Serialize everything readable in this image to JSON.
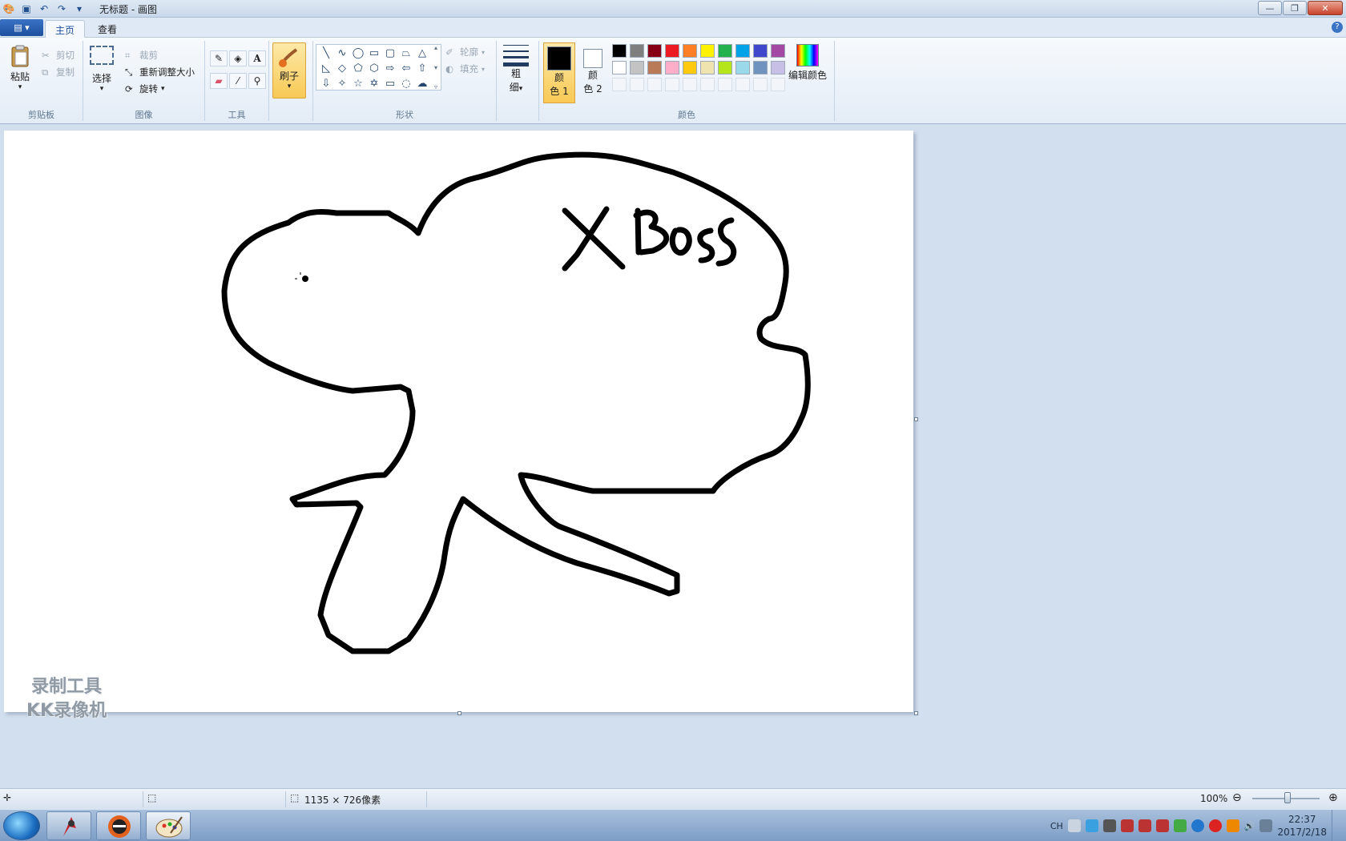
{
  "window": {
    "title": "无标题 - 画图"
  },
  "tabs": [
    {
      "label": "主页"
    },
    {
      "label": "查看"
    }
  ],
  "ribbon": {
    "clipboard": {
      "paste_label": "粘贴",
      "cut_label": "剪切",
      "copy_label": "复制",
      "group_label": "剪贴板"
    },
    "image": {
      "select_label": "选择",
      "crop_label": "裁剪",
      "resize_label": "重新调整大小",
      "rotate_label": "旋转",
      "group_label": "图像"
    },
    "tools": {
      "group_label": "工具"
    },
    "brushes": {
      "label": "刷子"
    },
    "shapes": {
      "outline_label": "轮廓",
      "fill_label": "填充",
      "group_label": "形状"
    },
    "size": {
      "label_line1": "粗",
      "label_line2": "细"
    },
    "colors": {
      "color1_line1": "颜",
      "color1_line2": "色 1",
      "color2_line1": "颜",
      "color2_line2": "色 2",
      "edit_label": "编辑颜色",
      "group_label": "颜色",
      "color1": "#000000",
      "color2": "#ffffff",
      "palette_row1": [
        "#000000",
        "#7f7f7f",
        "#880015",
        "#ed1c24",
        "#ff7f27",
        "#fff200",
        "#22b14c",
        "#00a2e8",
        "#3f48cc",
        "#a349a4"
      ],
      "palette_row2": [
        "#ffffff",
        "#c3c3c3",
        "#b97a57",
        "#ffaec9",
        "#ffc90e",
        "#efe4b0",
        "#b5e61d",
        "#99d9ea",
        "#7092be",
        "#c8bfe7"
      ]
    }
  },
  "canvas": {
    "handwriting": "XBoss"
  },
  "watermark": {
    "line1": "录制工具",
    "line2": "KK录像机"
  },
  "status": {
    "size_text": "1135 × 726像素",
    "zoom": "100%"
  },
  "taskbar": {
    "ime": "CH",
    "time": "22:37",
    "date": "2017/2/18"
  }
}
